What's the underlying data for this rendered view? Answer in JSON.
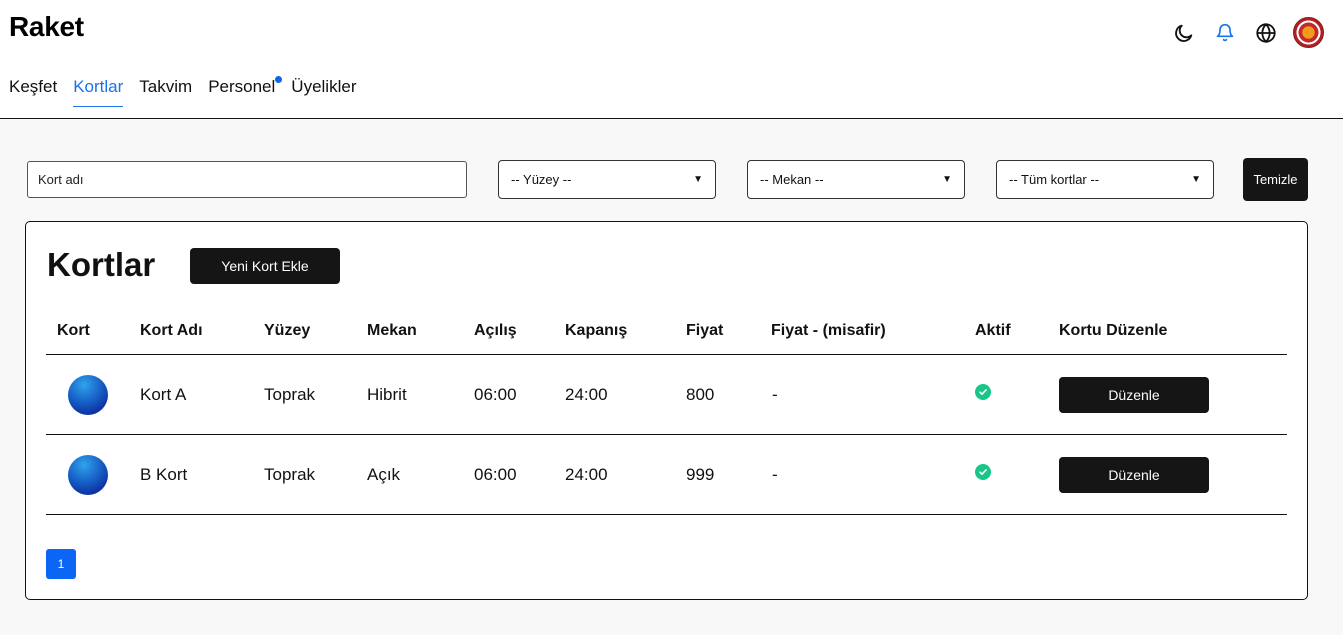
{
  "app": {
    "title": "Raket"
  },
  "nav": {
    "items": [
      {
        "label": "Keşfet",
        "active": false
      },
      {
        "label": "Kortlar",
        "active": true
      },
      {
        "label": "Takvim",
        "active": false
      },
      {
        "label": "Personel",
        "active": false,
        "badge": true
      },
      {
        "label": "Üyelikler",
        "active": false
      }
    ]
  },
  "header_icons": [
    "moon-icon",
    "bell-icon",
    "globe-icon",
    "avatar"
  ],
  "filters": {
    "name_placeholder": "Kort adı",
    "surface": "-- Yüzey --",
    "venue": "-- Mekan --",
    "status": "-- Tüm kortlar --",
    "clear_label": "Temizle"
  },
  "courts": {
    "title": "Kortlar",
    "add_label": "Yeni Kort Ekle",
    "columns": [
      "Kort",
      "Kort Adı",
      "Yüzey",
      "Mekan",
      "Açılış",
      "Kapanış",
      "Fiyat",
      "Fiyat - (misafir)",
      "Aktif",
      "Kortu Düzenle"
    ],
    "rows": [
      {
        "name": "Kort A",
        "surface": "Toprak",
        "venue": "Hibrit",
        "open": "06:00",
        "close": "24:00",
        "price": "800",
        "guest_price": "-",
        "active": true,
        "edit_label": "Düzenle"
      },
      {
        "name": "B Kort",
        "surface": "Toprak",
        "venue": "Açık",
        "open": "06:00",
        "close": "24:00",
        "price": "999",
        "guest_price": "-",
        "active": true,
        "edit_label": "Düzenle"
      }
    ],
    "page": "1"
  },
  "colors": {
    "accent": "#1a73e8",
    "primary_button": "#151515",
    "active_check": "#18c787",
    "page_button": "#0b66f5"
  }
}
